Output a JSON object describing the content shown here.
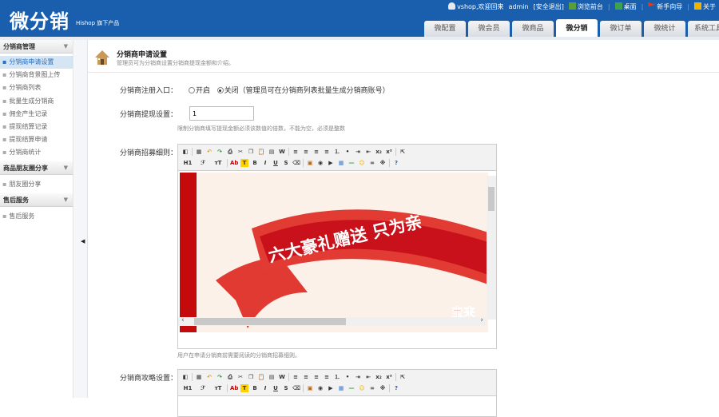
{
  "header": {
    "logo": "微分销",
    "slogan": "Hishop 旗下产品",
    "user_text": "vshop,欢迎回来",
    "user": "admin",
    "logout": "[安全退出]",
    "browse": "浏览前台",
    "desktop": "桌面",
    "guide": "新手向导",
    "about": "关于"
  },
  "tabs": [
    {
      "label": "微配置"
    },
    {
      "label": "微会员"
    },
    {
      "label": "微商品"
    },
    {
      "label": "微分销",
      "active": true
    },
    {
      "label": "微订单"
    },
    {
      "label": "微统计"
    },
    {
      "label": "系统工具"
    }
  ],
  "sidebar": {
    "sections": [
      {
        "title": "分销商管理",
        "items": [
          "分销商申请设置",
          "分销商背景图上传",
          "分销商列表",
          "批量生成分销商",
          "佣金产生记录",
          "提现结算记录",
          "提现结算申请",
          "分销商统计"
        ]
      },
      {
        "title": "商品朋友圈分享",
        "items": [
          "朋友圈分享"
        ]
      },
      {
        "title": "售后服务",
        "items": [
          "售后服务"
        ]
      }
    ]
  },
  "page": {
    "title": "分销商申请设置",
    "subtitle": "管理员可为分销商设置分销商提现金额和介绍。"
  },
  "form": {
    "register_label": "分销商注册入口：",
    "opt_open": "开启",
    "opt_close": "关闭（管理员可在分销商列表批量生成分销商账号）",
    "register_value": "关闭",
    "withdraw_label": "分销商提现设置：",
    "withdraw_value": "1",
    "withdraw_hint": "限制分销商填写提现金额必须该数值的倍数，不能为空，必须是整数",
    "rules_label": "分销商招募细则：",
    "rules_hint": "用户在申请分销商前需要阅读的分销商招募细则。",
    "banner_text": "六大豪礼赠送 只为亲",
    "banner_corner": "宝来",
    "strategy_label": "分销商攻略设置："
  },
  "toolbar": {
    "row1": [
      "source-icon",
      "|",
      "preview-icon",
      "undo-icon",
      "redo-icon",
      "print-icon",
      "cut-icon",
      "copy-icon",
      "paste-icon",
      "paste-text-icon",
      "paste-word-icon",
      "|",
      "align-left-icon",
      "align-center-icon",
      "align-right-icon",
      "justify-icon",
      "ordered-list-icon",
      "unordered-list-icon",
      "indent-icon",
      "outdent-icon",
      "subscript-icon",
      "superscript-icon",
      "|",
      "select-all-icon"
    ],
    "row2": [
      "heading-icon",
      "font-family-icon",
      "font-size-icon",
      "|",
      "font-color-icon",
      "highlight-icon",
      "bold-icon",
      "italic-icon",
      "underline-icon",
      "strikethrough-icon",
      "clear-format-icon",
      "|",
      "image-icon",
      "flash-icon",
      "media-icon",
      "table-icon",
      "hr-icon",
      "emoticon-icon",
      "link-icon",
      "unlink-icon",
      "|",
      "about-icon"
    ]
  },
  "colors": {
    "header": "#1a5fad",
    "accent": "#2a6fc0"
  }
}
